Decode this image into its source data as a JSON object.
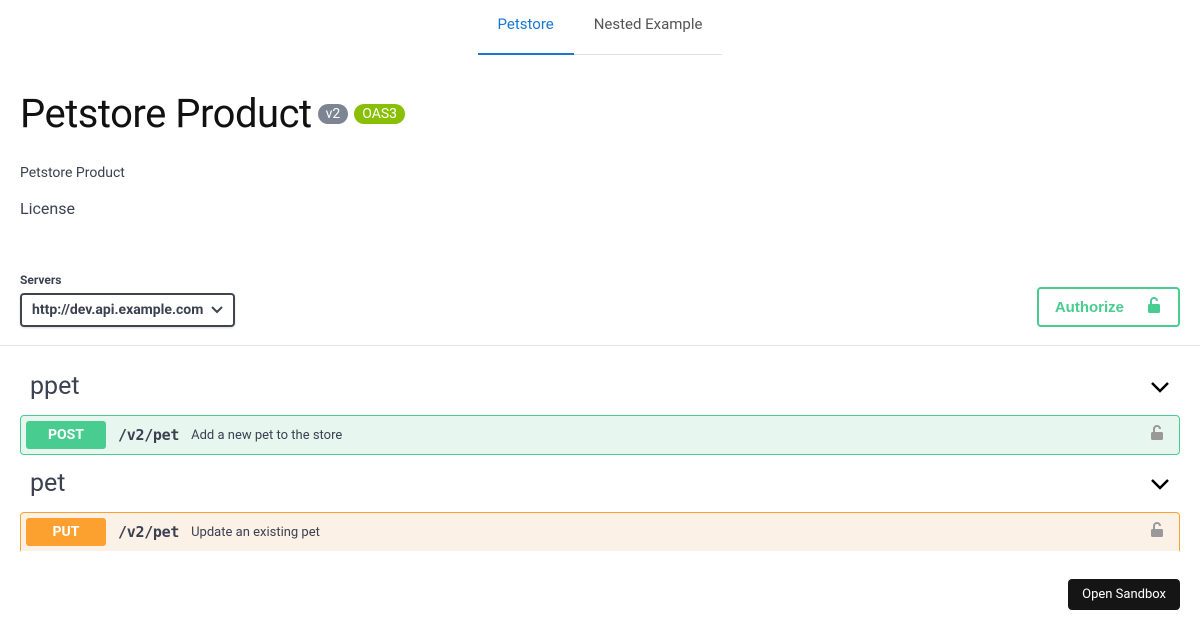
{
  "tabs": {
    "active": "Petstore",
    "inactive": "Nested Example"
  },
  "header": {
    "title": "Petstore Product",
    "version_badge": "v2",
    "oas_badge": "OAS3",
    "subtitle": "Petstore Product",
    "license": "License"
  },
  "servers": {
    "label": "Servers",
    "selected": "http://dev.api.example.com"
  },
  "authorize": {
    "label": "Authorize"
  },
  "sections": [
    {
      "name": "ppet",
      "ops": [
        {
          "method": "POST",
          "path": "/v2/pet",
          "desc": "Add a new pet to the store"
        }
      ]
    },
    {
      "name": "pet",
      "ops": [
        {
          "method": "PUT",
          "path": "/v2/pet",
          "desc": "Update an existing pet"
        }
      ]
    }
  ],
  "sandbox": {
    "label": "Open Sandbox"
  },
  "colors": {
    "post": "#49cc90",
    "put": "#fca130",
    "tab_active": "#1976d2",
    "oas_green": "#89bf04"
  }
}
